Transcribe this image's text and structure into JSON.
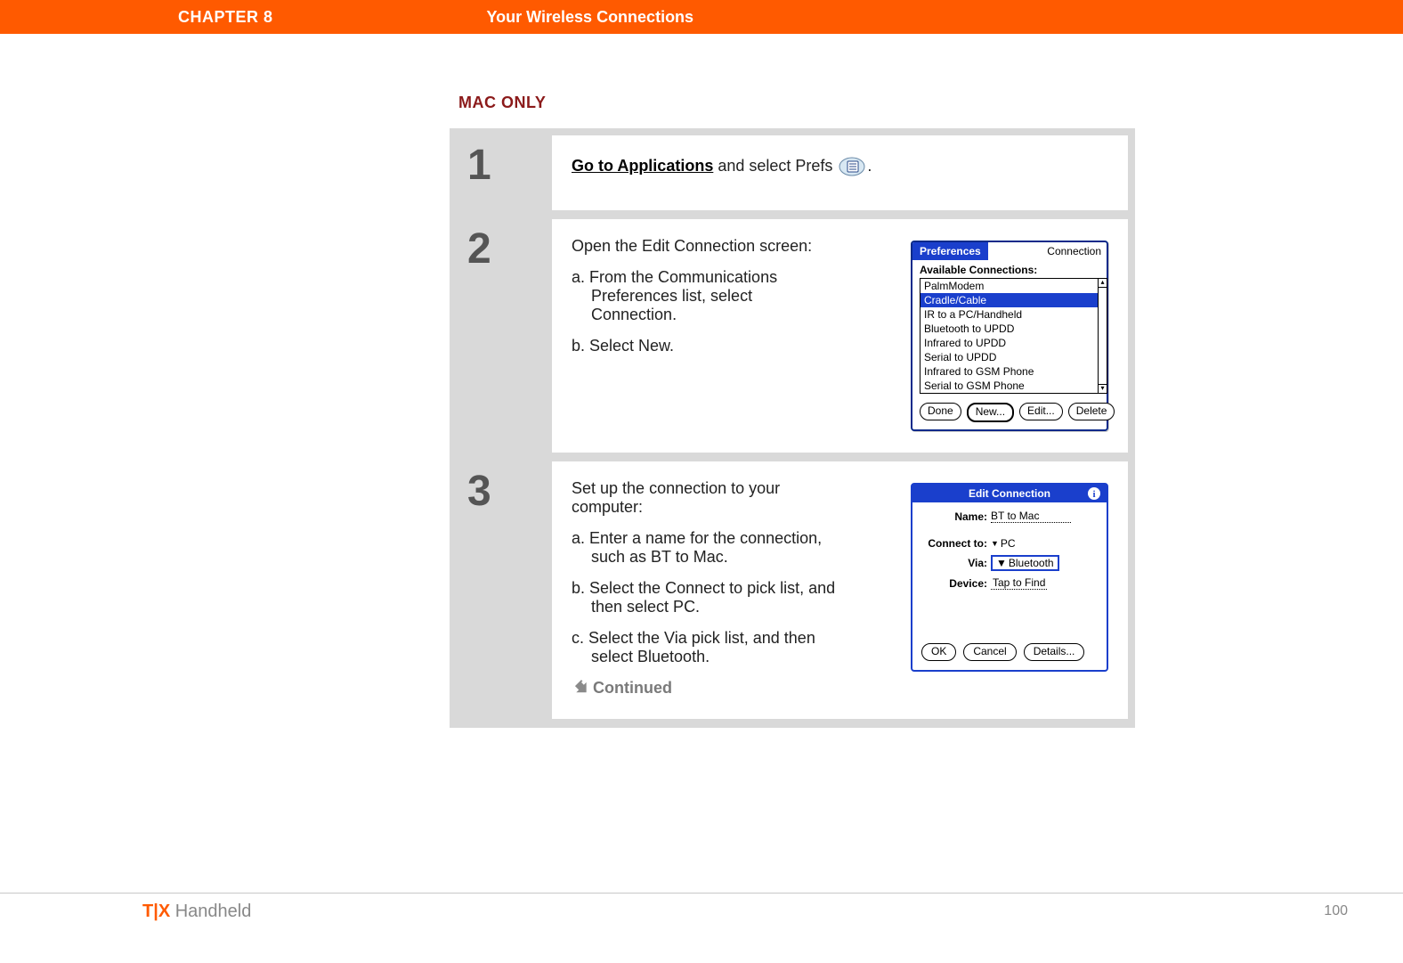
{
  "header": {
    "chapter": "CHAPTER 8",
    "title": "Your Wireless Connections"
  },
  "section_label": "MAC ONLY",
  "steps": {
    "s1": {
      "num": "1",
      "link": "Go to Applications",
      "after": " and select Prefs ",
      "period": "."
    },
    "s2": {
      "num": "2",
      "intro": "Open the Edit Connection screen:",
      "a": "a.  From the Communications Preferences list, select Connection.",
      "b": "b.  Select New."
    },
    "s3": {
      "num": "3",
      "intro": "Set up the connection to your computer:",
      "a": "a.  Enter a name for the connection, such as BT to Mac.",
      "b": "b.  Select the Connect to pick list, and then select PC.",
      "c": "c.  Select the Via pick list, and then select Bluetooth.",
      "continued": "Continued"
    }
  },
  "palm1": {
    "title_left": "Preferences",
    "title_right": "Connection",
    "section": "Available Connections:",
    "items": [
      "PalmModem",
      "Cradle/Cable",
      "IR to a PC/Handheld",
      "Bluetooth to UPDD",
      "Infrared to UPDD",
      "Serial to UPDD",
      "Infrared to GSM Phone",
      "Serial to GSM Phone"
    ],
    "selected_index": 1,
    "buttons": {
      "done": "Done",
      "new": "New...",
      "edit": "Edit...",
      "delete": "Delete"
    }
  },
  "palm2": {
    "title": "Edit Connection",
    "name_lbl": "Name:",
    "name_val": "BT to Mac",
    "connect_lbl": "Connect to:",
    "connect_val": "PC",
    "via_lbl": "Via:",
    "via_val": "Bluetooth",
    "device_lbl": "Device:",
    "device_val": "Tap to Find",
    "buttons": {
      "ok": "OK",
      "cancel": "Cancel",
      "details": "Details..."
    }
  },
  "footer": {
    "tx": "T|X",
    "handheld": " Handheld",
    "page": "100"
  }
}
